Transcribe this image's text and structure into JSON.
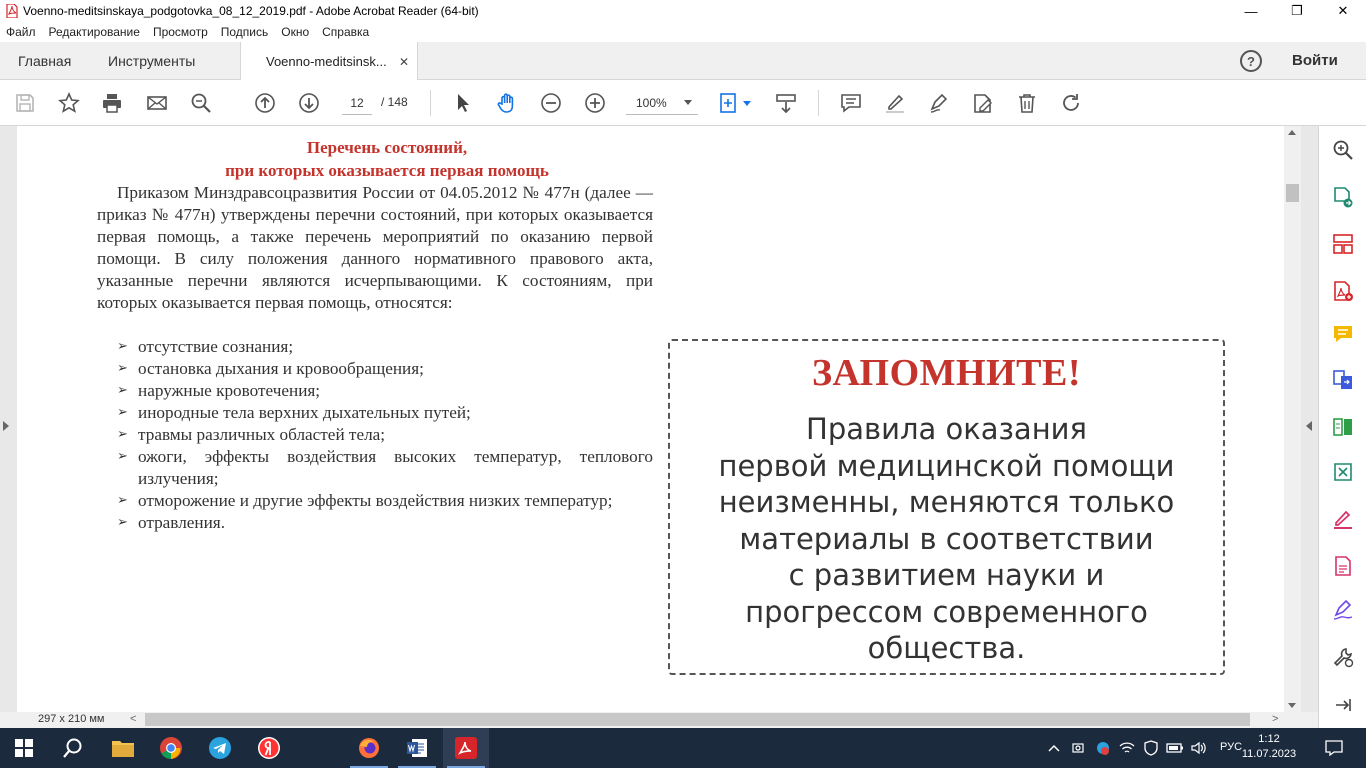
{
  "window": {
    "title": "Voenno-meditsinskaya_podgotovka_08_12_2019.pdf - Adobe Acrobat Reader (64-bit)",
    "controls": [
      "—",
      "❐",
      "✕"
    ]
  },
  "menu": [
    "Файл",
    "Редактирование",
    "Просмотр",
    "Подпись",
    "Окно",
    "Справка"
  ],
  "tabs": {
    "home": "Главная",
    "tools": "Инструменты",
    "doc": "Voenno-meditsinsk...",
    "close": "✕",
    "help": "?",
    "signin": "Войти"
  },
  "toolbar": {
    "page_current": "12",
    "page_total": "/ 148",
    "zoom": "100%"
  },
  "document": {
    "heading_line1": "Перечень состояний,",
    "heading_line2": "при которых оказывается первая помощь",
    "body": "Приказом Минздравсоцразвития России от 04.05.2012 № 477н (далее — приказ № 477н) утверждены перечни состояний, при которых оказывается первая помощь, а также перечень мероприятий по оказанию первой помощи. В силу положения данного нормативного правового акта, указанные перечни являются исчерпывающими. К состояниям, при которых оказывается первая помощь, относятся:",
    "list": [
      "отсутствие сознания;",
      "остановка дыхания и кровообращения;",
      "наружные кровотечения;",
      "инородные тела верхних дыхательных путей;",
      "травмы различных областей тела;",
      "ожоги, эффекты воздействия высоких температур, теплового излучения;",
      "отморожение и другие эффекты воздействия низких температур;",
      "отравления."
    ],
    "remember_title": "ЗАПОМНИТЕ!",
    "remember_lines": [
      "Правила оказания",
      "первой медицинской помощи",
      "неизменны, меняются только",
      "материалы в соответствии",
      "с развитием науки и",
      "прогрессом современного",
      "общества."
    ]
  },
  "statusbar": {
    "page_size": "297 x 210 мм"
  },
  "taskbar": {
    "lang": "РУС",
    "time": "1:12",
    "date": "11.07.2023"
  },
  "colors": {
    "heading_red": "#c4332c",
    "acrobat_red": "#d7262b",
    "tool_blue": "#1473e6",
    "taskbar": "#1c2a3e"
  }
}
